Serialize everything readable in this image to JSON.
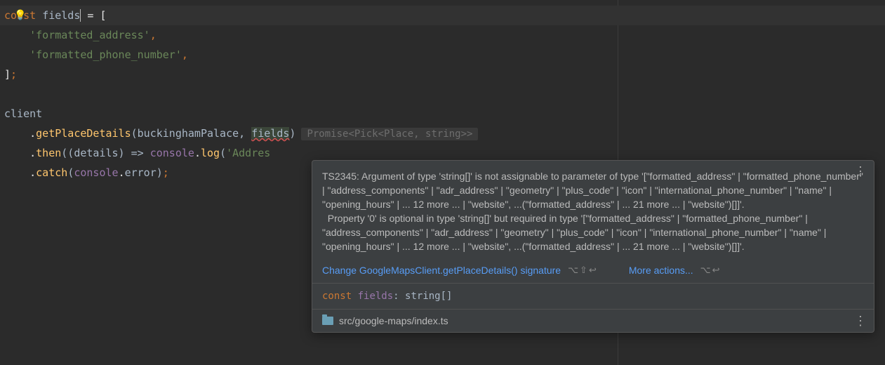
{
  "code": {
    "l1": {
      "kw": "const",
      "id": "fields",
      "eq": " = ["
    },
    "l2": {
      "str": "'formatted_address'"
    },
    "l3": {
      "str": "'formatted_phone_number'"
    },
    "l4": {
      "close": "];"
    },
    "l6": {
      "obj": "client"
    },
    "l7": {
      "dot": ".",
      "m": "getPlaceDetails",
      "args_a": "(buckinghamPalace, ",
      "fields": "fields",
      "args_b": ")",
      "hint": "Promise<Pick<Place, string>>"
    },
    "l8": {
      "dot": ".",
      "m": "then",
      "args": "((details) => ",
      "obj": "console",
      "dot2": ".",
      "m2": "log",
      "p2": "(",
      "str": "'Addres"
    },
    "l9": {
      "dot": ".",
      "m": "catch",
      "p": "(",
      "obj": "console",
      "dot2": ".",
      "id": "error",
      "end": ");"
    }
  },
  "tooltip": {
    "msg_line1": "TS2345: Argument of type 'string[]' is not assignable to parameter of type '[\"formatted_address\" | \"formatted_phone_number\" | \"address_components\" | \"adr_address\" | \"geometry\" | \"plus_code\" | \"icon\" | \"international_phone_number\" | \"name\" | \"opening_hours\" | ... 12 more ... | \"website\", ...(\"formatted_address\" | ... 21 more ... | \"website\")[]]'.",
    "msg_line2": "  Property '0' is optional in type 'string[]' but required in type '[\"formatted_address\" | \"formatted_phone_number\" | \"address_components\" | \"adr_address\" | \"geometry\" | \"plus_code\" | \"icon\" | \"international_phone_number\" | \"name\" | \"opening_hours\" | ... 12 more ... | \"website\", ...(\"formatted_address\" | ... 21 more ... | \"website\")[]]'.",
    "action1": "Change GoogleMapsClient.getPlaceDetails() signature",
    "shortcut1": "⌥⇧↩",
    "action2": "More actions...",
    "shortcut2": "⌥↩",
    "type_kw": "const",
    "type_id": "fields",
    "type_colon": ": ",
    "type_tp": "string[]",
    "footer_path": "src/google-maps/index.ts"
  }
}
